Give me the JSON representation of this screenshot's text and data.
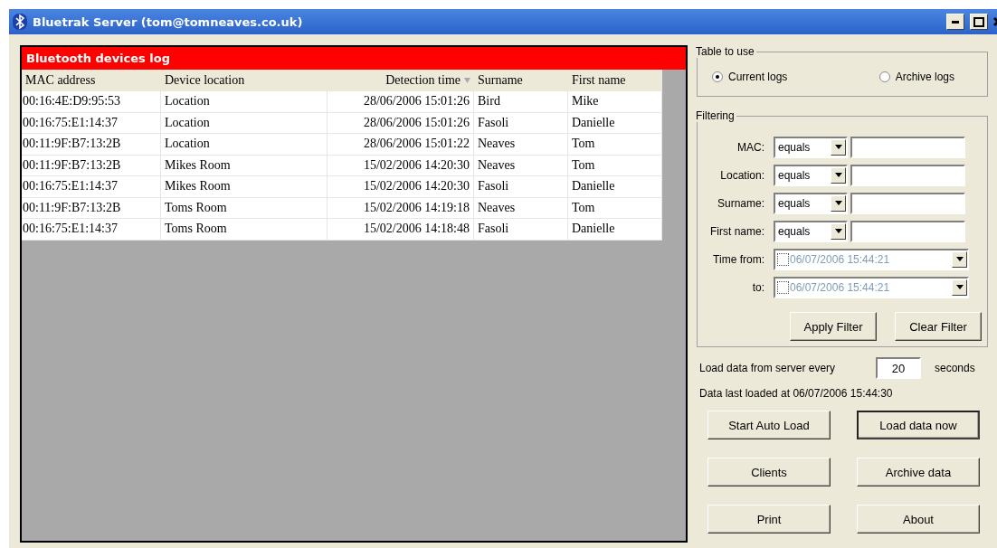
{
  "window": {
    "title": "Bluetrak Server (tom@tomneaves.co.uk)"
  },
  "log": {
    "title": "Bluetooth devices log",
    "columns": [
      {
        "label": "MAC address",
        "sorted": false
      },
      {
        "label": "Device location",
        "sorted": false
      },
      {
        "label": "Detection time",
        "sorted": true
      },
      {
        "label": "Surname",
        "sorted": false
      },
      {
        "label": "First name",
        "sorted": false
      }
    ],
    "rows": [
      [
        "00:16:4E:D9:95:53",
        "Location",
        "28/06/2006 15:01:26",
        "Bird",
        "Mike"
      ],
      [
        "00:16:75:E1:14:37",
        "Location",
        "28/06/2006 15:01:26",
        "Fasoli",
        "Danielle"
      ],
      [
        "00:11:9F:B7:13:2B",
        "Location",
        "28/06/2006 15:01:22",
        "Neaves",
        "Tom"
      ],
      [
        "00:11:9F:B7:13:2B",
        "Mikes Room",
        "15/02/2006 14:20:30",
        "Neaves",
        "Tom"
      ],
      [
        "00:16:75:E1:14:37",
        "Mikes Room",
        "15/02/2006 14:20:30",
        "Fasoli",
        "Danielle"
      ],
      [
        "00:11:9F:B7:13:2B",
        "Toms Room",
        "15/02/2006 14:19:18",
        "Neaves",
        "Tom"
      ],
      [
        "00:16:75:E1:14:37",
        "Toms Room",
        "15/02/2006 14:18:48",
        "Fasoli",
        "Danielle"
      ]
    ]
  },
  "table_to_use": {
    "title": "Table to use",
    "options": [
      {
        "label": "Current logs",
        "selected": true
      },
      {
        "label": "Archive logs",
        "selected": false
      }
    ]
  },
  "filtering": {
    "title": "Filtering",
    "fields": [
      {
        "kind": "text",
        "label": "MAC:",
        "operator": "equals"
      },
      {
        "kind": "text",
        "label": "Location:",
        "operator": "equals"
      },
      {
        "kind": "text",
        "label": "Surname:",
        "operator": "equals"
      },
      {
        "kind": "text",
        "label": "First name:",
        "operator": "equals"
      },
      {
        "kind": "date",
        "label": "Time from:",
        "value": "06/07/2006 15:44:21",
        "checked": false
      },
      {
        "kind": "date",
        "label": "to:",
        "value": "06/07/2006 15:44:21",
        "checked": false
      }
    ],
    "buttons": [
      "Apply Filter",
      "Clear Filter"
    ]
  },
  "auto_load": {
    "label": "Load data from server every",
    "value": "20",
    "unit": "seconds"
  },
  "last_loaded": "Data last loaded at 06/07/2006 15:44:30",
  "buttons": [
    {
      "label": "Start Auto Load",
      "default": false
    },
    {
      "label": "Load data now",
      "default": true
    },
    {
      "label": "Clients",
      "default": false
    },
    {
      "label": "Archive data",
      "default": false
    },
    {
      "label": "Print",
      "default": false
    },
    {
      "label": "About",
      "default": false
    }
  ]
}
